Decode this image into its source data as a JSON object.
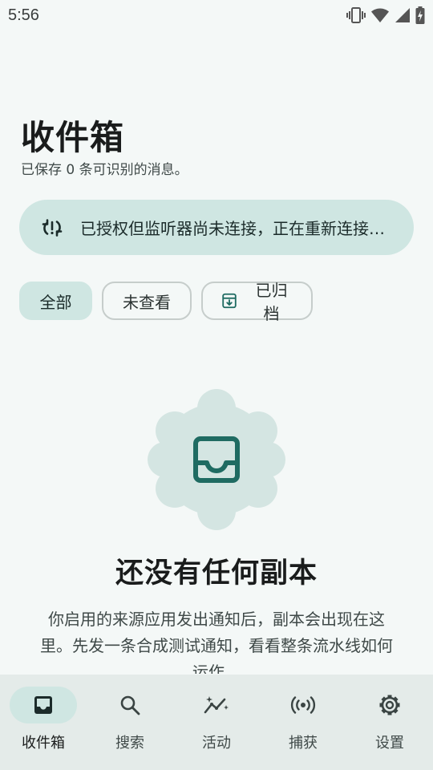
{
  "status_bar": {
    "time": "5:56",
    "icons": [
      "vibrate-icon",
      "wifi-icon",
      "signal-icon",
      "battery-charging-icon"
    ]
  },
  "header": {
    "title": "收件箱",
    "subtitle": "已保存 0 条可识别的消息。"
  },
  "notice": {
    "icon": "sync-alert-icon",
    "text": "已授权但监听器尚未连接，正在重新连接…"
  },
  "filters": [
    {
      "label": "全部",
      "selected": true
    },
    {
      "label": "未查看",
      "selected": false
    },
    {
      "label": "已归档",
      "selected": false,
      "icon": "archive-icon"
    }
  ],
  "empty_state": {
    "icon": "inbox-icon",
    "title": "还没有任何副本",
    "description": "你启用的来源应用发出通知后，副本会出现在这里。先发一条合成测试通知，看看整条流水线如何运作。"
  },
  "bottom_nav": [
    {
      "label": "收件箱",
      "icon": "inbox-icon",
      "active": true
    },
    {
      "label": "搜索",
      "icon": "search-icon",
      "active": false
    },
    {
      "label": "活动",
      "icon": "activity-icon",
      "active": false
    },
    {
      "label": "捕获",
      "icon": "capture-icon",
      "active": false
    },
    {
      "label": "设置",
      "icon": "gear-icon",
      "active": false
    }
  ],
  "colors": {
    "background": "#f4f8f7",
    "accent_container": "#cfe6e2",
    "accent": "#1f6b62",
    "nav_background": "#e4ebe9"
  }
}
